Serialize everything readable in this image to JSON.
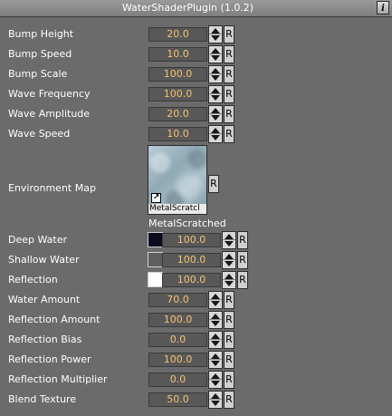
{
  "title": "WaterShaderPlugin (1.0.2)",
  "info_label": "i",
  "reset_label": "R",
  "params": [
    {
      "label": "Bump Height",
      "value": "20.0"
    },
    {
      "label": "Bump Speed",
      "value": "10.0"
    },
    {
      "label": "Bump Scale",
      "value": "100.0"
    },
    {
      "label": "Wave Frequency",
      "value": "100.0"
    },
    {
      "label": "Wave Amplitude",
      "value": "20.0"
    },
    {
      "label": "Wave Speed",
      "value": "10.0"
    }
  ],
  "environment_map": {
    "label": "Environment Map",
    "thumbnail_name": "MetalScratcl",
    "caption": "MetalScratched"
  },
  "colors": [
    {
      "label": "Deep Water",
      "swatch": "#0b0b1e",
      "value": "100.0"
    },
    {
      "label": "Shallow Water",
      "swatch": "#5e5e5e",
      "value": "100.0"
    },
    {
      "label": "Reflection",
      "swatch": "#ffffff",
      "value": "100.0"
    }
  ],
  "params2": [
    {
      "label": "Water Amount",
      "value": "70.0"
    },
    {
      "label": "Reflection Amount",
      "value": "100.0"
    },
    {
      "label": "Reflection Bias",
      "value": "0.0"
    },
    {
      "label": "Reflection Power",
      "value": "100.0"
    },
    {
      "label": "Reflection Multiplier",
      "value": "0.0"
    },
    {
      "label": "Blend Texture",
      "value": "50.0"
    }
  ]
}
